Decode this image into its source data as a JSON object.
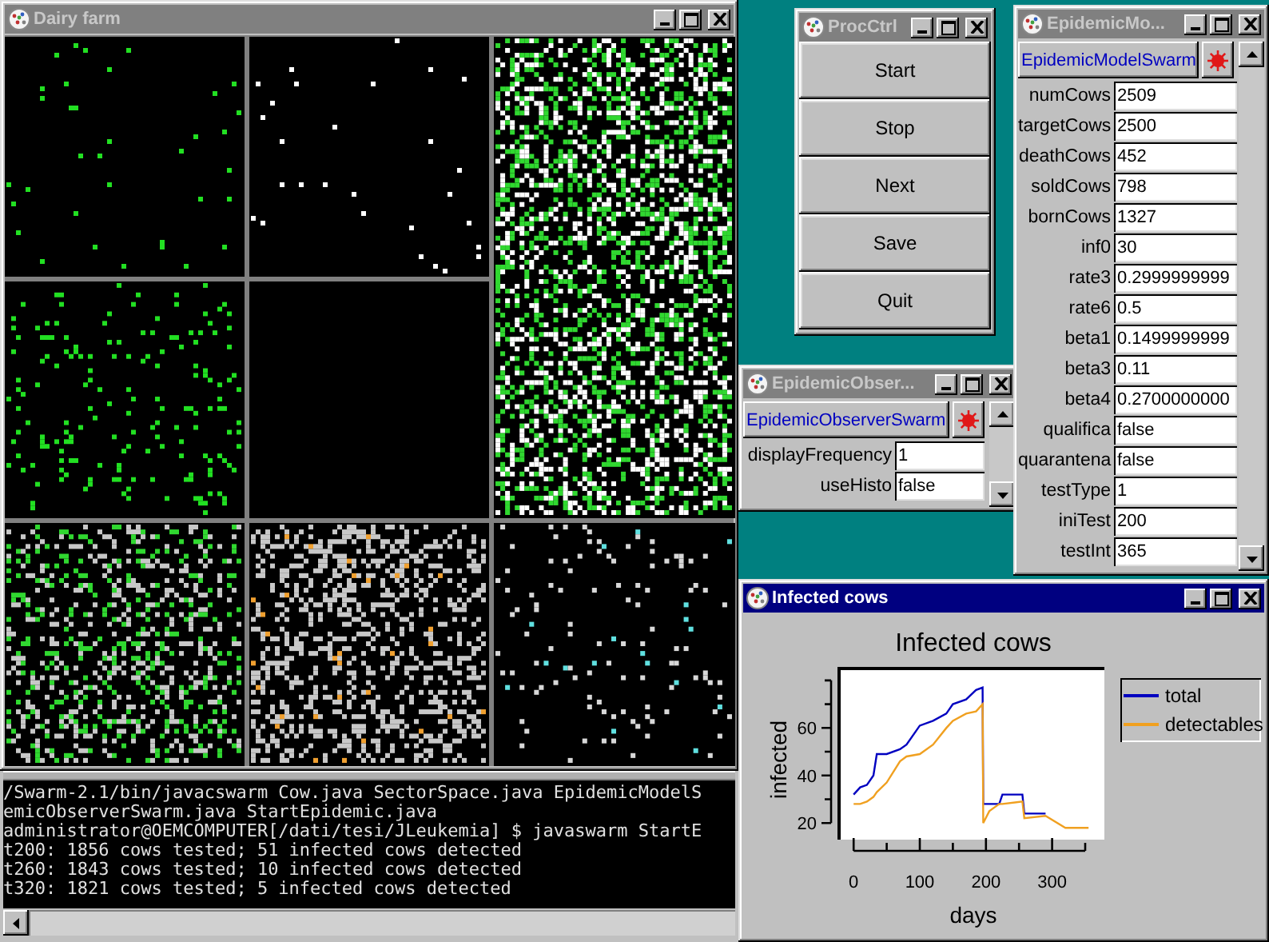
{
  "dairy_farm": {
    "title": "Dairy farm",
    "active": false
  },
  "proc_ctrl": {
    "title": "ProcCtrl",
    "active": false,
    "buttons": [
      "Start",
      "Stop",
      "Next",
      "Save",
      "Quit"
    ]
  },
  "model_window": {
    "title": "EpidemicMo...",
    "active": false,
    "swarm_button": "EpidemicModelSwarm",
    "fields": [
      {
        "label": "numCows",
        "value": "2509"
      },
      {
        "label": "targetCows",
        "value": "2500"
      },
      {
        "label": "deathCows",
        "value": "452"
      },
      {
        "label": "soldCows",
        "value": "798"
      },
      {
        "label": "bornCows",
        "value": "1327"
      },
      {
        "label": "inf0",
        "value": "30"
      },
      {
        "label": "rate3",
        "value": "0.2999999999"
      },
      {
        "label": "rate6",
        "value": "0.5"
      },
      {
        "label": "beta1",
        "value": "0.1499999999"
      },
      {
        "label": "beta3",
        "value": "0.11"
      },
      {
        "label": "beta4",
        "value": "0.2700000000"
      },
      {
        "label": "qualifica",
        "value": "false"
      },
      {
        "label": "quarantena",
        "value": "false"
      },
      {
        "label": "testType",
        "value": "1"
      },
      {
        "label": "iniTest",
        "value": "200"
      },
      {
        "label": "testInt",
        "value": "365"
      }
    ]
  },
  "observer_window": {
    "title": "EpidemicObser...",
    "active": false,
    "swarm_button": "EpidemicObserverSwarm",
    "fields": [
      {
        "label": "displayFrequency",
        "value": "1"
      },
      {
        "label": "useHisto",
        "value": "false"
      }
    ]
  },
  "console": {
    "lines": [
      "/Swarm-2.1/bin/javacswarm Cow.java SectorSpace.java EpidemicModelS",
      "emicObserverSwarm.java StartEpidemic.java",
      "administrator@OEMCOMPUTER[/dati/tesi/JLeukemia] $ javaswarm StartE",
      "t200: 1856 cows tested; 51 infected cows detected",
      "t260: 1843 cows tested; 10 infected cows detected",
      "t320: 1821 cows tested; 5 infected cows detected"
    ]
  },
  "chart_window": {
    "title": "Infected cows",
    "active": true,
    "chart_data": {
      "type": "line",
      "title": "Infected cows",
      "xlabel": "days",
      "ylabel": "infected",
      "x": [
        0,
        10,
        20,
        30,
        35,
        50,
        70,
        80,
        100,
        120,
        140,
        150,
        170,
        185,
        195,
        196,
        205,
        220,
        225,
        255,
        258,
        290,
        320,
        355
      ],
      "series": [
        {
          "name": "total",
          "color": "#0000c0",
          "values": [
            32,
            35,
            36,
            40,
            49,
            49,
            51,
            53,
            61,
            63,
            66,
            70,
            72,
            76,
            77,
            28,
            28,
            28,
            32,
            32,
            24,
            24,
            null,
            null
          ]
        },
        {
          "name": "detectables",
          "color": "#f0a020",
          "values": [
            28,
            28,
            29,
            31,
            33,
            37,
            46,
            48,
            49,
            53,
            60,
            63,
            66,
            67,
            70,
            20,
            25,
            28,
            28,
            29,
            22,
            23,
            18,
            18
          ]
        }
      ],
      "xlim": [
        -22,
        379
      ],
      "ylim": [
        13,
        85
      ],
      "xticks": [
        0,
        100,
        200,
        300
      ],
      "yticks": [
        20,
        40,
        60
      ]
    }
  }
}
